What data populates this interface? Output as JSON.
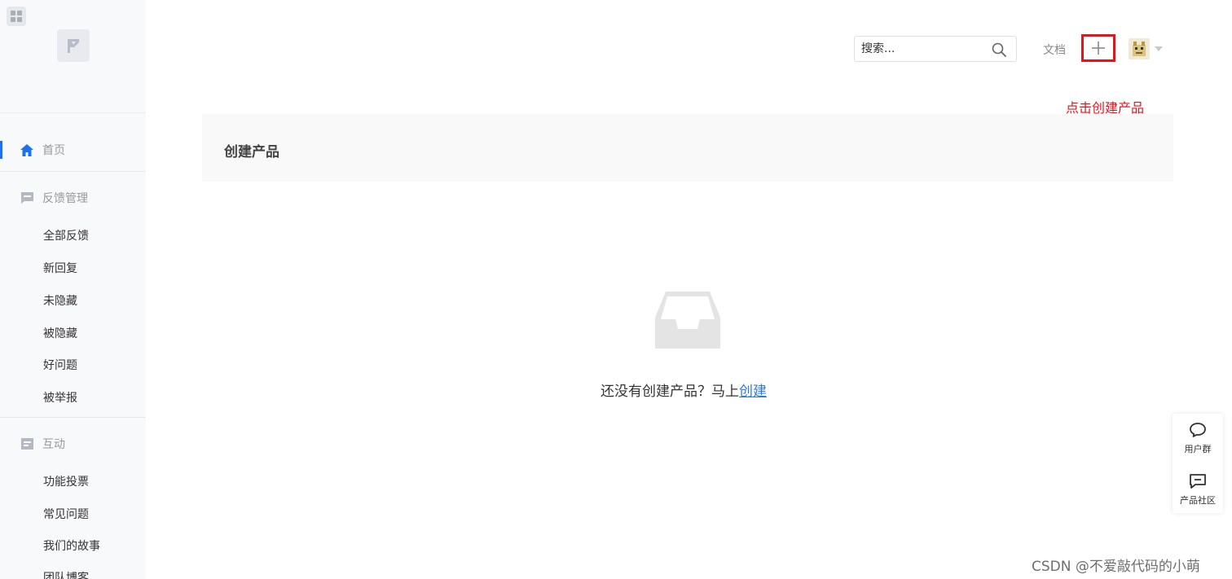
{
  "sidebar": {
    "home_label": "首页",
    "feedback_section_label": "反馈管理",
    "feedback_items": [
      "全部反馈",
      "新回复",
      "未隐藏",
      "被隐藏",
      "好问题",
      "被举报"
    ],
    "interaction_section_label": "互动",
    "interaction_items": [
      "功能投票",
      "常见问题",
      "我们的故事",
      "团队博客"
    ],
    "active_color": "#1a73e8"
  },
  "header": {
    "search_placeholder": "搜索...",
    "docs_label": "文档",
    "add_label": "+",
    "annotation_text": "点击创建产品",
    "annotation_color": "#e0161e"
  },
  "main": {
    "title": "创建产品",
    "empty_message": "还没有创建产品？马上",
    "create_link": "创建",
    "link_color": "#2f7ad8"
  },
  "float_widgets": {
    "user_group_label": "用户群",
    "community_label": "产品社区"
  },
  "watermark": "CSDN @不爱敲代码的小萌"
}
